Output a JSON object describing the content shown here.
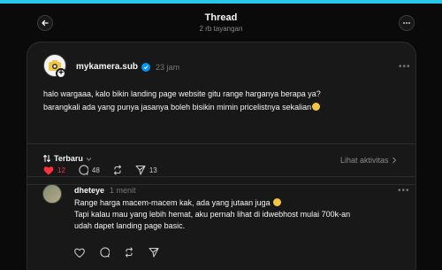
{
  "header": {
    "title": "Thread",
    "subtitle": "2 rb tayangan"
  },
  "post": {
    "username": "mykamera.sub",
    "time": "23 jam",
    "text_line1": "halo wargaaa, kalo bikin landing page website gitu range harganya berapa ya?",
    "text_line2": "barangkali ada yang punya jasanya boleh bisikin mimin pricelistnya sekalian",
    "likes": "12",
    "comments": "48",
    "shares": "13",
    "like_color": "#ff3040"
  },
  "sort": {
    "label": "Terbaru",
    "activity_label": "Lihat aktivitas"
  },
  "reply": {
    "username": "dheteye",
    "time": "1 menit",
    "line1": "Range harga macem-macem kak, ada yang jutaan juga",
    "line2": "Tapi kalau mau yang lebih hemat, aku pernah lihat di idwebhost mulai 700k-an",
    "line3": "udah dapet landing page basic."
  }
}
